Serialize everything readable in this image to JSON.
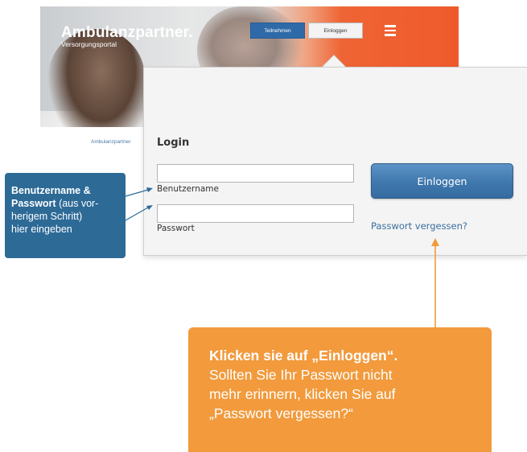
{
  "site": {
    "logo": "Ambulanzpartner.",
    "subtitle": "Versorgungsportal",
    "btn_join": "Teilnehmen",
    "btn_login": "Einloggen",
    "breadcrumb": "Ambulanzpartner"
  },
  "login": {
    "title": "Login",
    "username_label": "Benutzername",
    "username_value": "",
    "password_label": "Passwort",
    "password_value": "",
    "submit_label": "Einloggen",
    "forgot_link": "Passwort vergessen?"
  },
  "callout_left": {
    "bold1": "Benutzername &",
    "bold2": "Passwort",
    "rest1": " (aus vor-",
    "rest2": "herigem Schritt)",
    "rest3": "hier eingeben"
  },
  "callout_bottom": {
    "title": "Klicken sie  auf „Einloggen“.",
    "line1": "Sollten Sie Ihr Passwort nicht",
    "line2": "mehr erinnern, klicken Sie auf",
    "line3": "„Passwort vergessen?“"
  },
  "colors": {
    "accent_blue": "#2d6a96",
    "accent_orange": "#f29a3c",
    "link_blue": "#3b6e9e",
    "hero_orange": "#ef5a2c"
  },
  "icons": {
    "menu": "hamburger-menu-icon"
  }
}
